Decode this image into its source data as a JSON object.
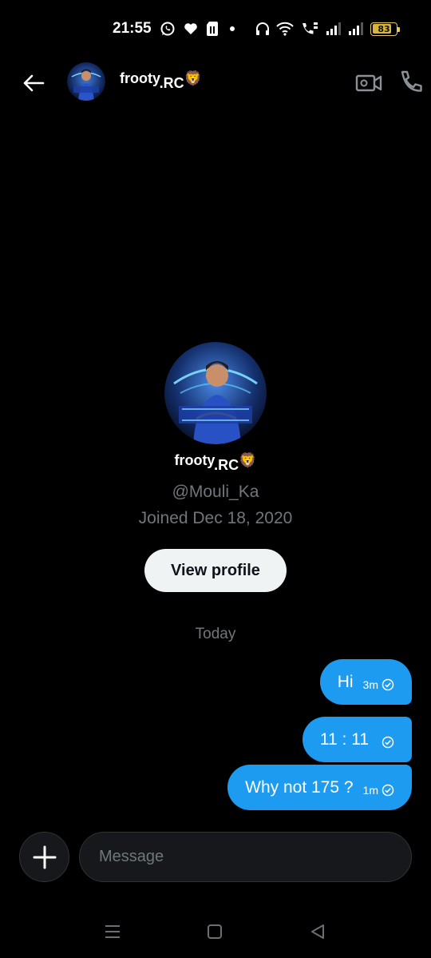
{
  "status_bar": {
    "time": "21:55",
    "battery": "83",
    "battery_level": 0.83,
    "icons": [
      "whatsapp-icon",
      "heart-icon",
      "sim-card-icon",
      "dot-icon",
      "headphones-icon",
      "wifi-icon",
      "volte-call-icon",
      "signal-icon",
      "signal-icon",
      "battery-icon"
    ]
  },
  "header": {
    "name": "frooty",
    "name_suffix": ".RC",
    "emoji": "🦁",
    "icons": [
      "back-arrow-icon",
      "video-call-icon",
      "phone-icon"
    ]
  },
  "profile": {
    "name": "frooty",
    "name_suffix": ".RC",
    "emoji": "🦁",
    "handle": "@Mouli_Ka",
    "joined": "Joined Dec 18, 2020",
    "view_profile_label": "View profile"
  },
  "conversation": {
    "day_label": "Today",
    "messages": [
      {
        "text": "Hi",
        "time": "3m"
      },
      {
        "text": "11 : 11",
        "time": ""
      },
      {
        "text": "Why not 175 ?",
        "time": "1m"
      }
    ]
  },
  "composer": {
    "placeholder": "Message"
  },
  "colors": {
    "background": "#000000",
    "bubble": "#1d9bf0",
    "muted_text": "#71767b",
    "button_bg": "#eff3f4"
  }
}
